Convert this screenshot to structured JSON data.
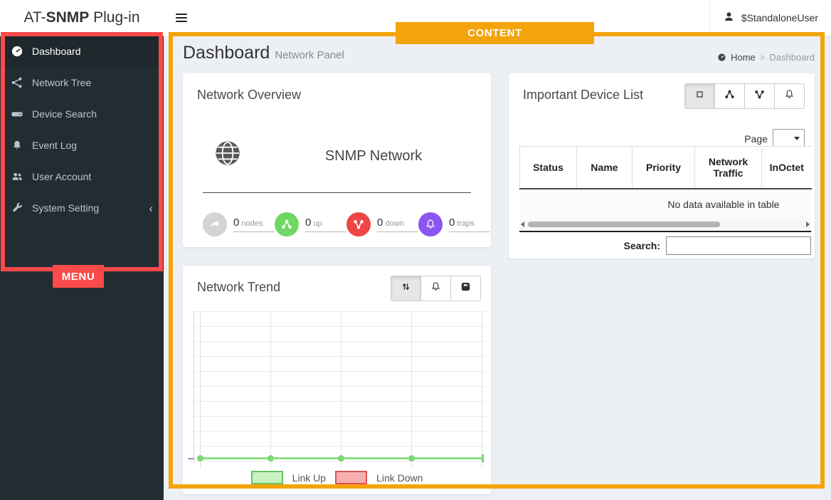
{
  "annotations": {
    "menu_label": "MENU",
    "content_label": "CONTENT",
    "menu_color": "#fb4a4a",
    "content_color": "#f3a40a"
  },
  "header": {
    "logo_prefix": "AT-",
    "logo_bold": "SNMP",
    "logo_suffix": " Plug-in",
    "user": "$StandaloneUser"
  },
  "sidebar": {
    "items": [
      {
        "label": "Dashboard",
        "icon": "gauge-icon",
        "active": true
      },
      {
        "label": "Network Tree",
        "icon": "network-tree-icon",
        "active": false
      },
      {
        "label": "Device Search",
        "icon": "hdd-icon",
        "active": false
      },
      {
        "label": "Event Log",
        "icon": "bell-icon",
        "active": false
      },
      {
        "label": "User Account",
        "icon": "users-icon",
        "active": false
      },
      {
        "label": "System Setting",
        "icon": "wrench-icon",
        "active": false,
        "chevron": "‹"
      }
    ]
  },
  "content": {
    "page_title": "Dashboard",
    "page_subtitle": "Network Panel",
    "breadcrumb": {
      "home": "Home",
      "separator": ">",
      "current": "Dashboard"
    },
    "network_overview": {
      "title": "Network Overview",
      "network_label": "SNMP Network",
      "stats": [
        {
          "value": "0",
          "label": "nodes",
          "color": "#d4d4d4",
          "icon": "share-icon"
        },
        {
          "value": "0",
          "label": "up",
          "color": "#6fd862",
          "icon": "nodes-up-icon"
        },
        {
          "value": "0",
          "label": "down",
          "color": "#ef4545",
          "icon": "nodes-down-icon"
        },
        {
          "value": "0",
          "label": "traps",
          "color": "#8a55f0",
          "icon": "bell-icon"
        }
      ]
    },
    "device_list": {
      "title": "Important Device List",
      "toolbar_icons": [
        "square-icon",
        "nodes-up-icon",
        "nodes-down-icon",
        "bell-icon"
      ],
      "page_label": "Page",
      "columns": [
        "Status",
        "Name",
        "Priority",
        "Network Traffic",
        "InOctet"
      ],
      "empty_text": "No data available in table",
      "search_label": "Search:",
      "search_value": ""
    },
    "network_trend": {
      "title": "Network Trend",
      "toolbar_icons": [
        "sort-arrows-icon",
        "bell-icon",
        "scale-icon"
      ],
      "legend": [
        {
          "label": "Link Up",
          "fill": "#c9f2c0",
          "border": "#67c162"
        },
        {
          "label": "Link Down",
          "fill": "#f5afaf",
          "border": "#e05252"
        }
      ]
    }
  },
  "chart_data": {
    "type": "line",
    "title": "Network Trend",
    "x": [
      1,
      2,
      3,
      4,
      5
    ],
    "series": [
      {
        "name": "Link Up",
        "color": "#7cd873",
        "values": [
          0,
          0,
          0,
          0,
          0
        ]
      },
      {
        "name": "Link Down",
        "color": "#e05252",
        "values": [
          0,
          0,
          0,
          0,
          0
        ]
      }
    ],
    "xlabel": "",
    "ylabel": "",
    "x_tick_labels": [
      "",
      "",
      "",
      "",
      ""
    ],
    "y_tick_labels": [],
    "ylim": [
      0,
      10
    ],
    "grid": true,
    "legend_position": "bottom"
  }
}
